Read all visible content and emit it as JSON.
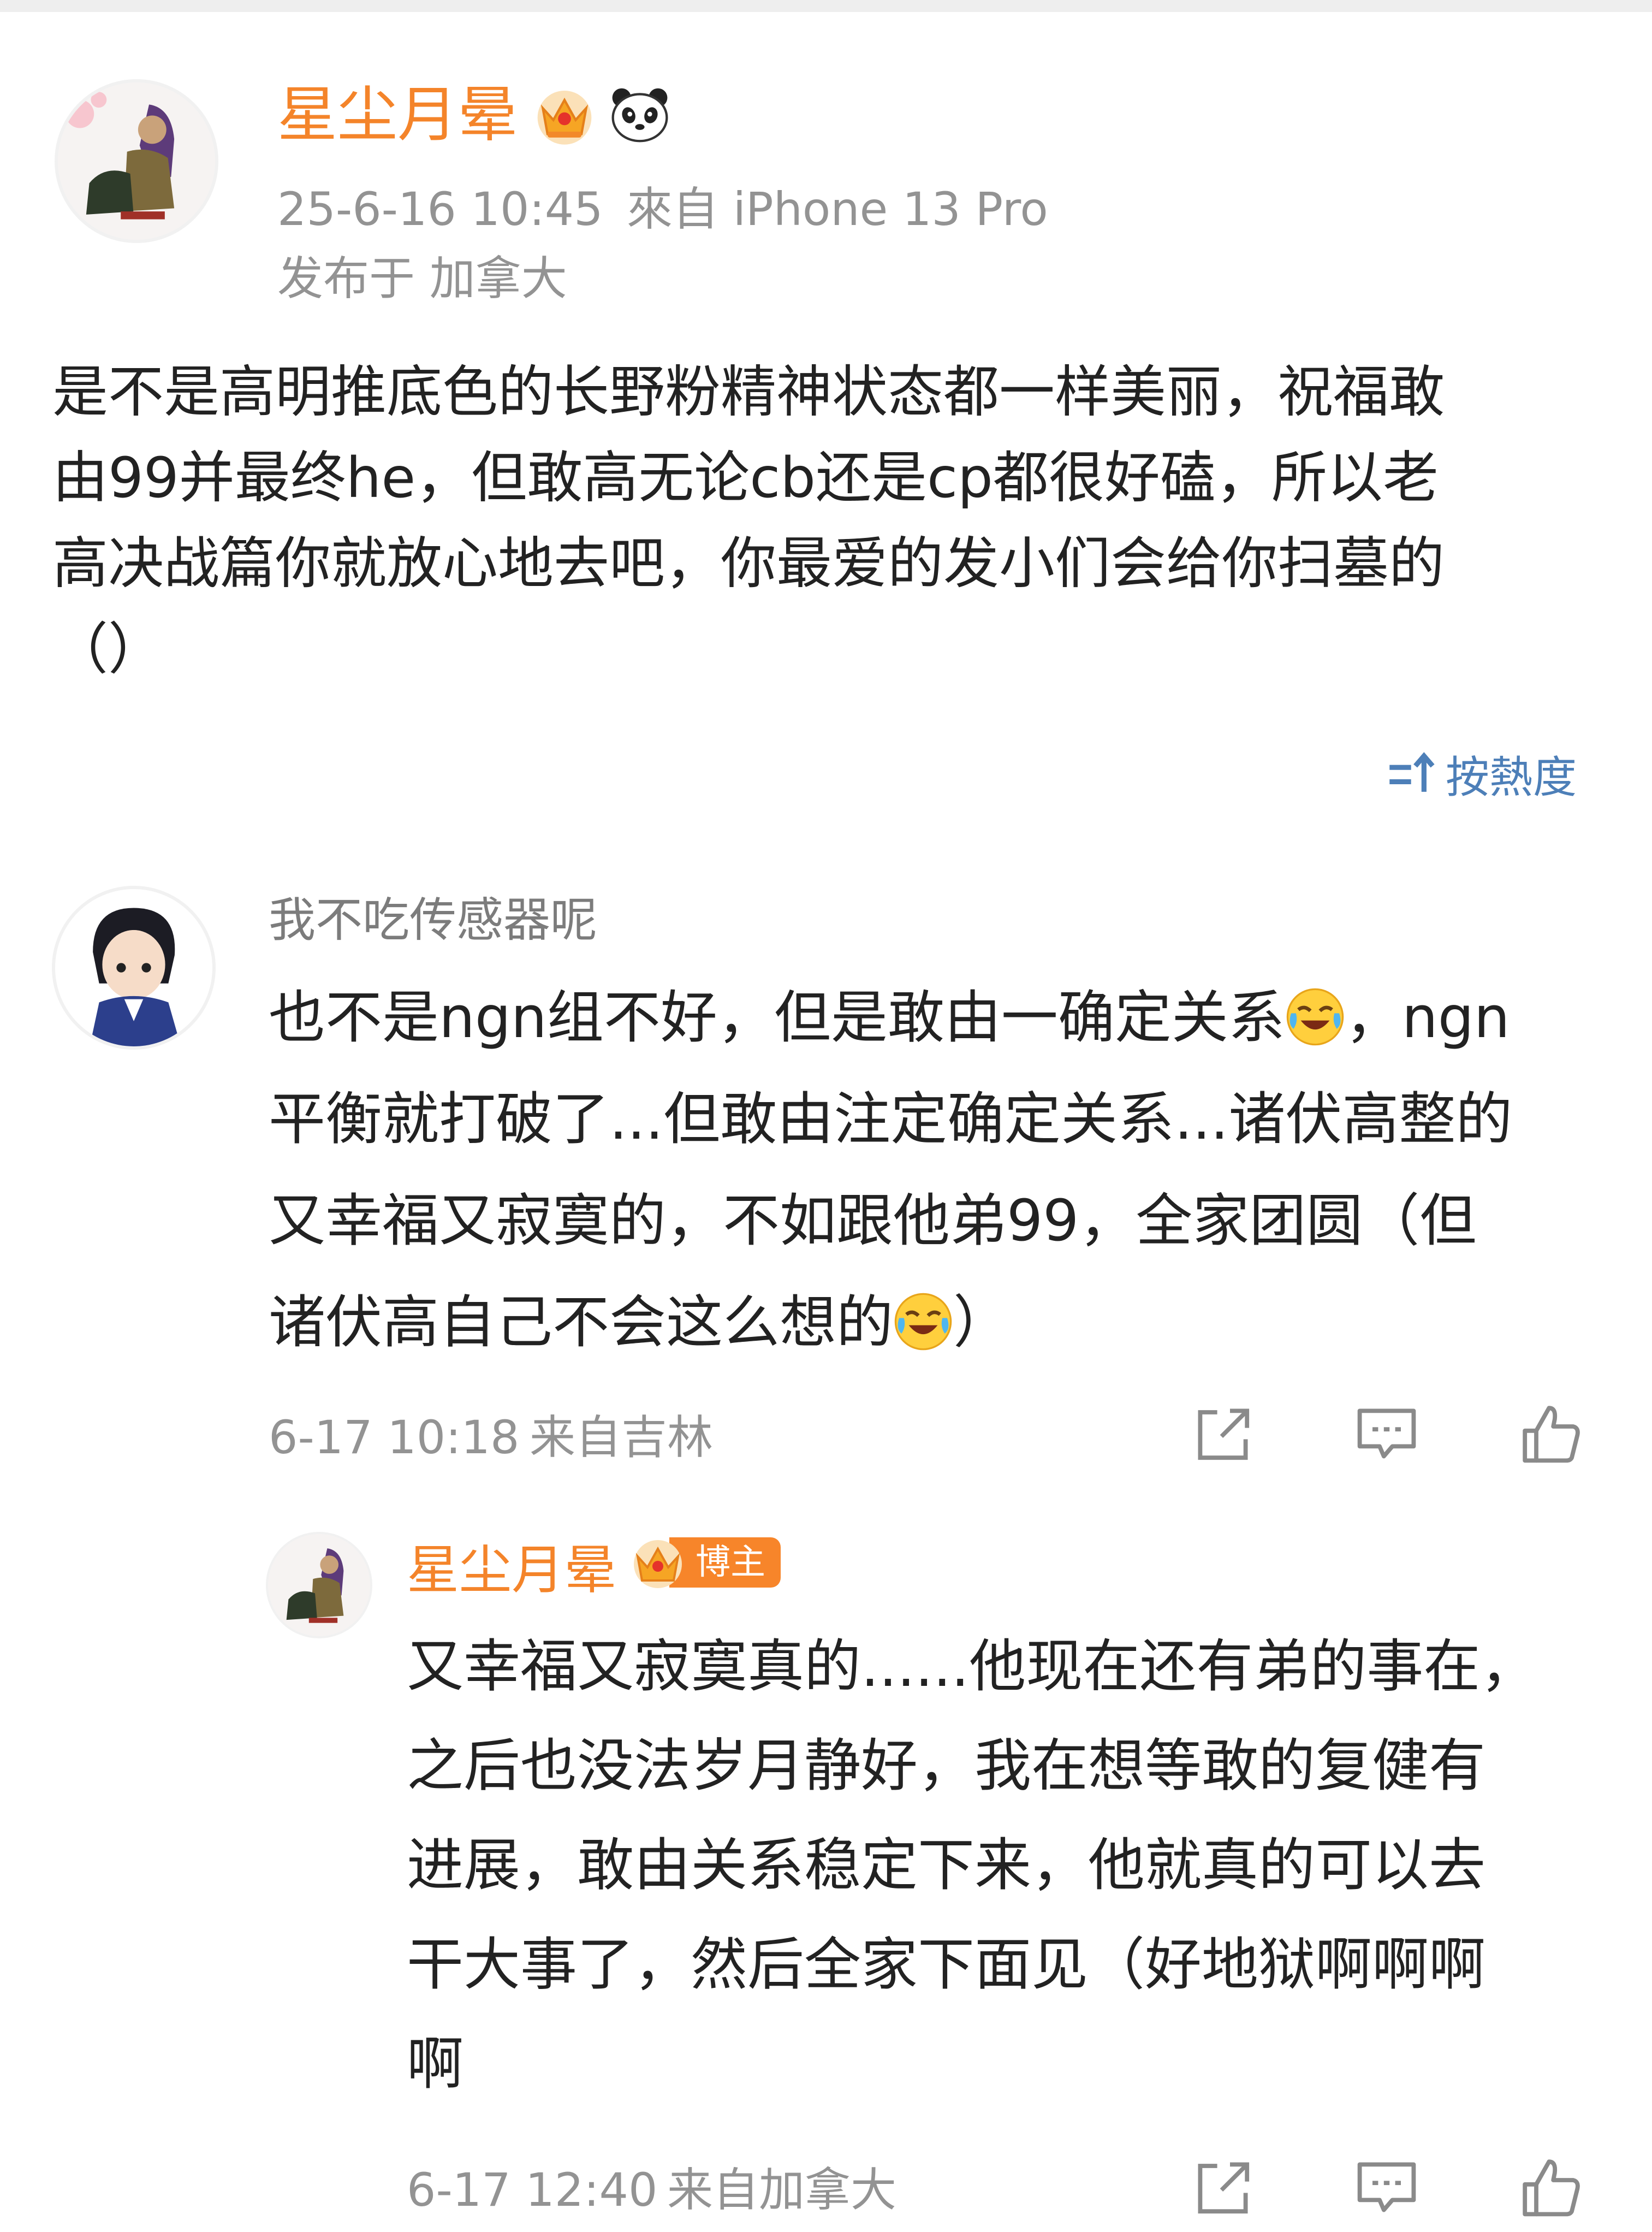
{
  "post": {
    "author": "星尘月晕",
    "badges": [
      "crown-badge-icon",
      "panda-badge-icon"
    ],
    "timestamp": "25-6-16 10:45",
    "source": "來自 iPhone 13 Pro",
    "location": "发布于 加拿大",
    "body_lines": [
      "是不是高明推底色的长野粉精神状态都一样美丽，祝福敢",
      "由99并最终he，但敢高无论cb还是cp都很好磕，所以老",
      "高决战篇你就放心地去吧，你最爱的发小们会给你扫墓的",
      "（）"
    ]
  },
  "sort": {
    "icon": "sort-icon",
    "label": "按熱度"
  },
  "comment": {
    "author": "我不吃传感器呢",
    "line1_text": "也不是ngn组不好，但是敢由一确定关系",
    "line1_tail": "，ngn",
    "line2": "平衡就打破了...但敢由注定确定关系...诸伏高整的",
    "line3": "又幸福又寂寞的，不如跟他弟99，全家团圆（但",
    "line4_text": "诸伏高自己不会这么想的",
    "line4_tail": "）",
    "emoji": "laugh-cry-emoji",
    "timestamp": "6-17 10:18",
    "source": "来自吉林"
  },
  "reply": {
    "author": "星尘月晕",
    "badge_label": "博主",
    "body_lines": [
      "又幸福又寂寞真的......他现在还有弟的事在，",
      "之后也没法岁月静好，我在想等敢的复健有",
      "进展，敢由关系稳定下来，他就真的可以去",
      "干大事了，然后全家下面见（好地狱啊啊啊",
      "啊"
    ],
    "timestamp": "6-17 12:40",
    "source": "来自加拿大"
  },
  "actions": [
    "share-icon",
    "comment-icon",
    "like-icon"
  ],
  "colors": {
    "author_orange": "#f4842a",
    "meta_gray": "#939393",
    "link_blue": "#4d7fb8",
    "text": "#222222"
  }
}
